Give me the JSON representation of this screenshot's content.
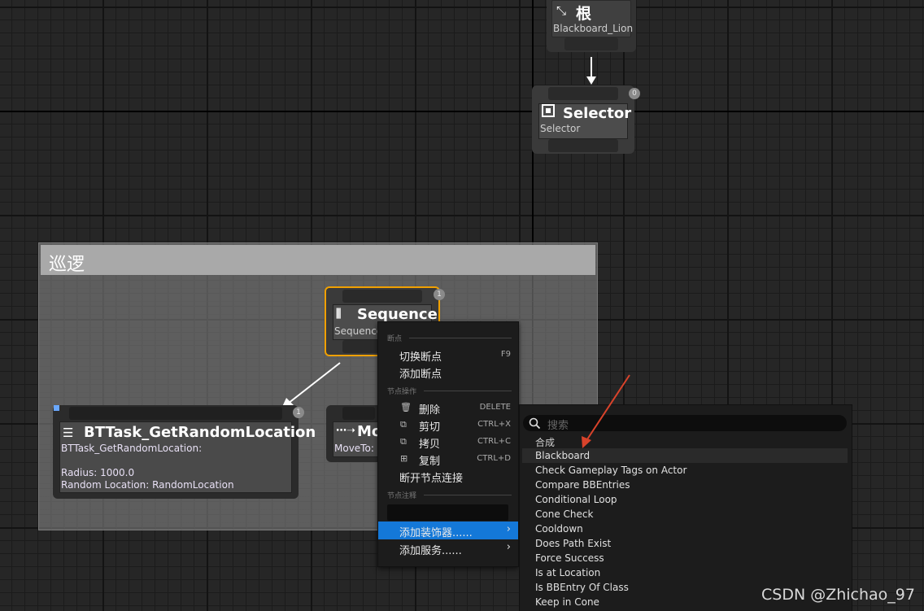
{
  "nodes": {
    "root": {
      "title": "根",
      "subtitle": "Blackboard_Lion"
    },
    "selector": {
      "title": "Selector",
      "subtitle": "Selector",
      "badge": "0"
    },
    "sequence": {
      "title": "Sequence",
      "subtitle": "Sequence",
      "badge": "1"
    },
    "task": {
      "title": "BTTask_GetRandomLocation",
      "line1": "BTTask_GetRandomLocation:",
      "line2": "Radius: 1000.0",
      "line3": "Random Location: RandomLocation",
      "badge": "1"
    },
    "moveto": {
      "title": "Mo",
      "subtitle": "MoveTo:"
    }
  },
  "comment": {
    "title": "巡逻"
  },
  "context_menu": {
    "section_breakpoints": "断点",
    "toggle_breakpoint": "切换断点",
    "toggle_breakpoint_shortcut": "F9",
    "add_breakpoint": "添加断点",
    "section_node_actions": "节点操作",
    "delete": "删除",
    "delete_shortcut": "DELETE",
    "cut": "剪切",
    "cut_shortcut": "CTRL+X",
    "copy": "拷贝",
    "copy_shortcut": "CTRL+C",
    "duplicate": "复制",
    "duplicate_shortcut": "CTRL+D",
    "break_links": "断开节点连接",
    "section_node_comment": "节点注释",
    "add_decorator": "添加装饰器......",
    "add_service": "添加服务......"
  },
  "submenu": {
    "search_placeholder": "搜索",
    "category": "合成",
    "items": [
      "Blackboard",
      "Check Gameplay Tags on Actor",
      "Compare BBEntries",
      "Conditional Loop",
      "Cone Check",
      "Cooldown",
      "Does Path Exist",
      "Force Success",
      "Is at Location",
      "Is BBEntry Of Class",
      "Keep in Cone"
    ]
  },
  "watermark": "CSDN @Zhichao_97",
  "colors": {
    "accent": "#1478d8",
    "task_purple": "#6a2ac2",
    "selected_outline": "#f0a000",
    "annotation_arrow": "#d9432b"
  },
  "icons": [
    "root-icon",
    "selector-icon",
    "sequence-icon",
    "task-icon",
    "moveto-icon",
    "trash-icon",
    "cut-icon",
    "copy-icon",
    "duplicate-icon",
    "submenu-arrow-icon",
    "search-icon"
  ]
}
